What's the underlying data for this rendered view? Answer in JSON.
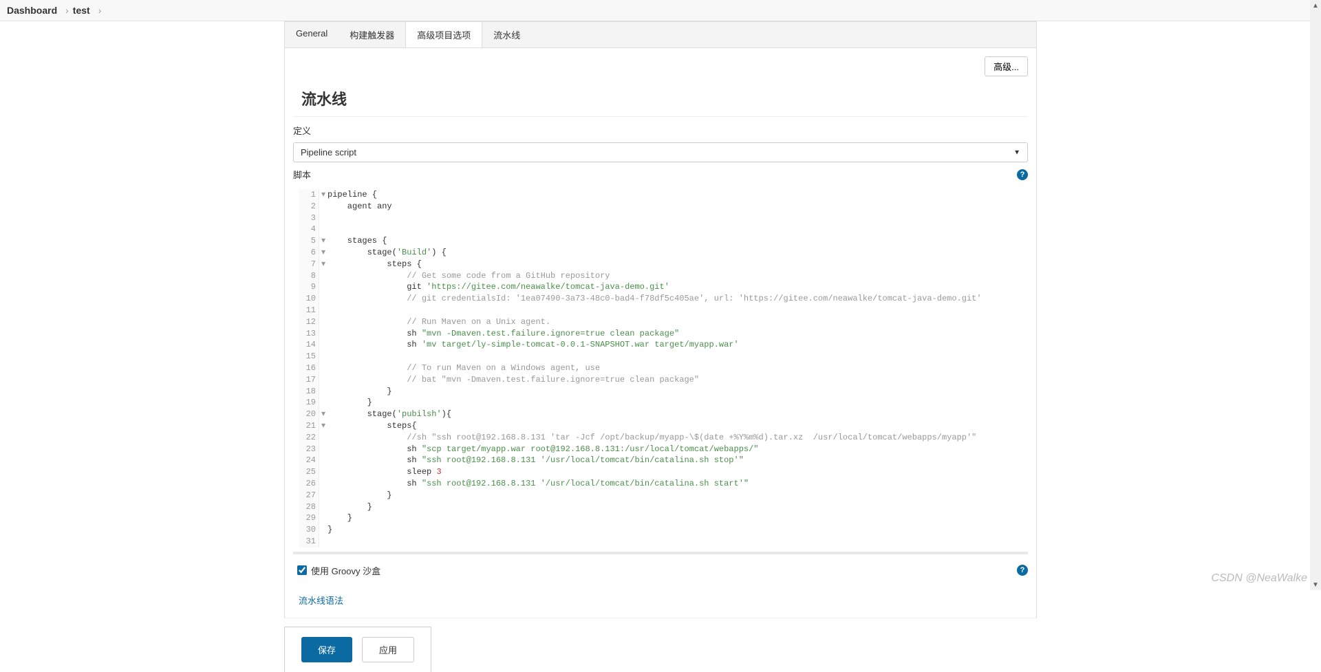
{
  "breadcrumb": {
    "root": "Dashboard",
    "crumb2": "test"
  },
  "tabs": [
    "General",
    "构建触发器",
    "高级项目选项",
    "流水线"
  ],
  "active_tab": 2,
  "advanced_btn": "高级...",
  "section_title": "流水线",
  "definition_label": "定义",
  "definition_value": "Pipeline script",
  "script_label": "脚本",
  "sandbox_label": "使用 Groovy 沙盒",
  "sandbox_checked": true,
  "syntax_link": "流水线语法",
  "save_btn": "保存",
  "apply_btn": "应用",
  "watermark": "CSDN @NeaWalke",
  "code": [
    {
      "n": 1,
      "fold": "▾",
      "html": "pipeline {"
    },
    {
      "n": 2,
      "html": "    agent any"
    },
    {
      "n": 3,
      "html": ""
    },
    {
      "n": 4,
      "html": ""
    },
    {
      "n": 5,
      "fold": "▾",
      "html": "    stages {"
    },
    {
      "n": 6,
      "fold": "▾",
      "html": "        stage(<span class='k-green'>'Build'</span>) {"
    },
    {
      "n": 7,
      "fold": "▾",
      "html": "            steps {"
    },
    {
      "n": 8,
      "html": "                <span class='k-grey'>// Get some code from a GitHub repository</span>"
    },
    {
      "n": 9,
      "html": "                git <span class='k-green'>'https://gitee.com/neawalke/tomcat-java-demo.git'</span>"
    },
    {
      "n": 10,
      "html": "                <span class='k-grey'>// git credentialsId: '1ea07490-3a73-48c0-bad4-f78df5c405ae', url: 'https://gitee.com/neawalke/tomcat-java-demo.git'</span>"
    },
    {
      "n": 11,
      "html": ""
    },
    {
      "n": 12,
      "html": "                <span class='k-grey'>// Run Maven on a Unix agent.</span>"
    },
    {
      "n": 13,
      "html": "                sh <span class='k-green'>\"mvn -Dmaven.test.failure.ignore=true clean package\"</span>"
    },
    {
      "n": 14,
      "html": "                sh <span class='k-green'>'mv target/ly-simple-tomcat-0.0.1-SNAPSHOT.war target/myapp.war'</span>"
    },
    {
      "n": 15,
      "html": ""
    },
    {
      "n": 16,
      "html": "                <span class='k-grey'>// To run Maven on a Windows agent, use</span>"
    },
    {
      "n": 17,
      "html": "                <span class='k-grey'>// bat \"mvn -Dmaven.test.failure.ignore=true clean package\"</span>"
    },
    {
      "n": 18,
      "html": "            }"
    },
    {
      "n": 19,
      "html": "        }"
    },
    {
      "n": 20,
      "fold": "▾",
      "html": "        stage(<span class='k-green'>'pubilsh'</span>){"
    },
    {
      "n": 21,
      "fold": "▾",
      "html": "            steps{"
    },
    {
      "n": 22,
      "html": "                <span class='k-grey'>//sh \"ssh root@192.168.8.131 'tar -Jcf /opt/backup/myapp-\\$(date +%Y%m%d).tar.xz  /usr/local/tomcat/webapps/myapp'\"</span>"
    },
    {
      "n": 23,
      "html": "                sh <span class='k-green'>\"scp target/myapp.war root@192.168.8.131:/usr/local/tomcat/webapps/\"</span>"
    },
    {
      "n": 24,
      "html": "                sh <span class='k-green'>\"ssh root@192.168.8.131 '/usr/local/tomcat/bin/catalina.sh stop'\"</span>"
    },
    {
      "n": 25,
      "html": "                sleep <span class='k-red'>3</span>"
    },
    {
      "n": 26,
      "html": "                sh <span class='k-green'>\"ssh root@192.168.8.131 '/usr/local/tomcat/bin/catalina.sh start'\"</span>"
    },
    {
      "n": 27,
      "html": "            }"
    },
    {
      "n": 28,
      "html": "        }"
    },
    {
      "n": 29,
      "html": "    }"
    },
    {
      "n": 30,
      "html": "}"
    },
    {
      "n": 31,
      "html": ""
    }
  ]
}
